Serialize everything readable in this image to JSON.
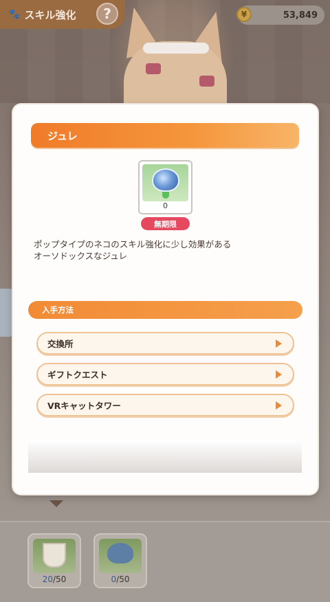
{
  "topbar": {
    "title": "スキル強化",
    "help_label": "?",
    "coins": "53,849"
  },
  "modal": {
    "title": "ジュレ",
    "item": {
      "count": "0",
      "badge": "無期限"
    },
    "description_lines": [
      "ポップタイプのネコのスキル強化に少し効果がある",
      "オーソドックスなジュレ"
    ],
    "section_title": "入手方法",
    "sources": [
      {
        "label": "交換所"
      },
      {
        "label": "ギフトクエスト"
      },
      {
        "label": "VRキャットタワー"
      }
    ]
  },
  "tray": {
    "slots": [
      {
        "current": "20",
        "max": "/50"
      },
      {
        "current": "0",
        "max": "/50"
      }
    ]
  },
  "colors": {
    "header_orange": "#f07b2a",
    "badge_red": "#e5495f",
    "arrow_orange": "#ec8a37"
  }
}
